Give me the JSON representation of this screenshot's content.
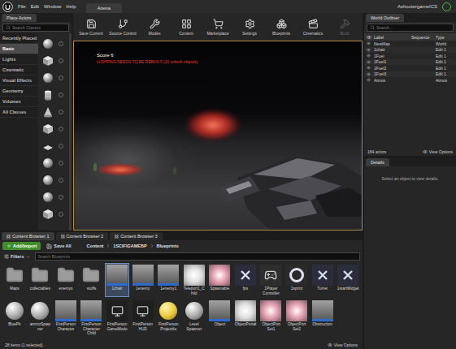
{
  "window": {
    "title": "AshootergameICS",
    "level_tab": "Arena"
  },
  "menu": [
    "File",
    "Edit",
    "Window",
    "Help"
  ],
  "place_actors": {
    "title": "Place Actors",
    "search": {
      "placeholder": "Search Classes"
    },
    "categories": [
      {
        "label": "Recently Placed",
        "selected": false
      },
      {
        "label": "Basic",
        "selected": true
      },
      {
        "label": "Lights",
        "selected": false
      },
      {
        "label": "Cinematic",
        "selected": false
      },
      {
        "label": "Visual Effects",
        "selected": false
      },
      {
        "label": "Geometry",
        "selected": false
      },
      {
        "label": "Volumes",
        "selected": false
      },
      {
        "label": "All Classes",
        "selected": false
      }
    ]
  },
  "toolbar": [
    {
      "label": "Save Current",
      "disabled": false
    },
    {
      "label": "Source Control",
      "disabled": false
    },
    {
      "label": "Modes",
      "disabled": false
    },
    {
      "label": "Content",
      "disabled": false
    },
    {
      "label": "Marketplace",
      "disabled": false
    },
    {
      "label": "Settings",
      "disabled": false
    },
    {
      "label": "Blueprints",
      "disabled": false
    },
    {
      "label": "Cinematics",
      "disabled": false
    },
    {
      "label": "Build",
      "disabled": true
    }
  ],
  "viewport": {
    "score": "Score 6",
    "warning": "LIGHTING NEEDS TO BE REBUILT (10 unbuilt objects)"
  },
  "outliner": {
    "title": "World Outliner",
    "search": {
      "placeholder": "Search..."
    },
    "columns": [
      "Label",
      "Sequence",
      "Type"
    ],
    "rows": [
      {
        "label": "NewMap",
        "type": "World"
      },
      {
        "label": "1chair",
        "type": "Edit 1"
      },
      {
        "label": "1Fuel",
        "type": "Edit 1"
      },
      {
        "label": "1Fuel1",
        "type": "Edit 1"
      },
      {
        "label": "1Fuel2",
        "type": "Edit 1"
      },
      {
        "label": "1Fuel3",
        "type": "Edit 1"
      },
      {
        "label": "Atmos",
        "type": "Atmos"
      }
    ],
    "count": "184 actors",
    "view_options": "View Options"
  },
  "details": {
    "title": "Details",
    "message": "Select an object to view details."
  },
  "content_browser": {
    "tabs": [
      {
        "label": "Content Browser 1",
        "selected": true
      },
      {
        "label": "Content Browser 2",
        "selected": false
      },
      {
        "label": "Content Browser 3",
        "selected": false
      }
    ],
    "add_import": "Add/Import",
    "save_all": "Save All",
    "path": [
      "Content",
      "1SCIFIGAMEBP",
      "Blueprints"
    ],
    "filters": "Filters",
    "search": {
      "placeholder": "Search Blueprints"
    },
    "assets": [
      {
        "name": "Maps",
        "kind": "folder",
        "selected": false
      },
      {
        "name": "collectables",
        "kind": "folder",
        "selected": false
      },
      {
        "name": "enemys",
        "kind": "folder",
        "selected": false
      },
      {
        "name": "stuffs",
        "kind": "folder",
        "selected": false
      },
      {
        "name": "1chair",
        "kind": "blueprint",
        "selected": true
      },
      {
        "name": "1enemy",
        "kind": "blueprint",
        "selected": false
      },
      {
        "name": "1enemy1",
        "kind": "blueprint",
        "selected": false
      },
      {
        "name": "Teleport1_Child",
        "kind": "material",
        "selected": false
      },
      {
        "name": "Spawnable",
        "kind": "particle",
        "selected": false
      },
      {
        "name": "fps",
        "kind": "widget",
        "selected": false
      },
      {
        "name": "1Player Controller",
        "kind": "controller",
        "selected": false
      },
      {
        "name": "1sprint",
        "kind": "ring",
        "selected": false
      },
      {
        "name": "Turret",
        "kind": "widget",
        "selected": false
      },
      {
        "name": "1startWidget",
        "kind": "widget",
        "selected": false
      },
      {
        "name": "BluePit",
        "kind": "sphere",
        "selected": false
      },
      {
        "name": "ammoSpawner",
        "kind": "sphere",
        "selected": false
      },
      {
        "name": "FirstPerson Character",
        "kind": "blueprint",
        "selected": false
      },
      {
        "name": "FirstPerson Character Child",
        "kind": "blueprint",
        "selected": false
      },
      {
        "name": "FirstPerson GameMode",
        "kind": "hud",
        "selected": false
      },
      {
        "name": "FirstPerson HUD",
        "kind": "hud",
        "selected": false
      },
      {
        "name": "FirstPerson Projectile",
        "kind": "projectile",
        "selected": false
      },
      {
        "name": "Level Spawner",
        "kind": "sphere",
        "selected": false
      },
      {
        "name": "Object",
        "kind": "blueprint",
        "selected": false
      },
      {
        "name": "ObjectPortal",
        "kind": "material",
        "selected": false
      },
      {
        "name": "ObjectPort Set1",
        "kind": "particle",
        "selected": false
      },
      {
        "name": "ObjectPort Set2",
        "kind": "particle",
        "selected": false
      },
      {
        "name": "Obstruction",
        "kind": "blueprint",
        "selected": false
      }
    ],
    "status": "28 items (1 selected)",
    "view_options": "View Options"
  }
}
